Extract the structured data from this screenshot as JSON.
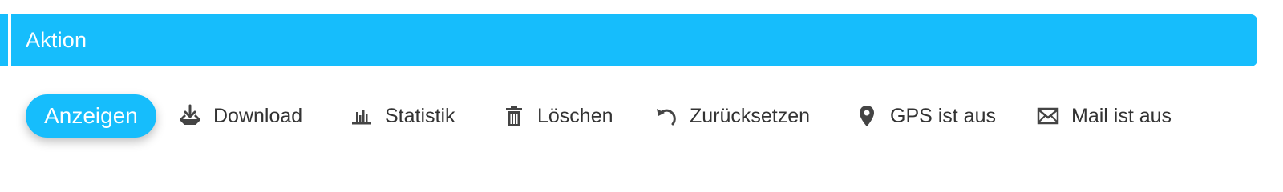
{
  "header": {
    "title": "Aktion"
  },
  "toolbar": {
    "primary_label": "Anzeigen",
    "actions": [
      {
        "label": "Download",
        "icon": "download-icon"
      },
      {
        "label": "Statistik",
        "icon": "bar-chart-icon"
      },
      {
        "label": "Löschen",
        "icon": "trash-icon"
      },
      {
        "label": "Zurücksetzen",
        "icon": "undo-icon"
      },
      {
        "label": "GPS ist aus",
        "icon": "location-pin-icon"
      },
      {
        "label": "Mail ist aus",
        "icon": "envelope-icon"
      }
    ]
  },
  "colors": {
    "accent": "#16bdfc",
    "text": "#333333",
    "icon": "#444444"
  }
}
